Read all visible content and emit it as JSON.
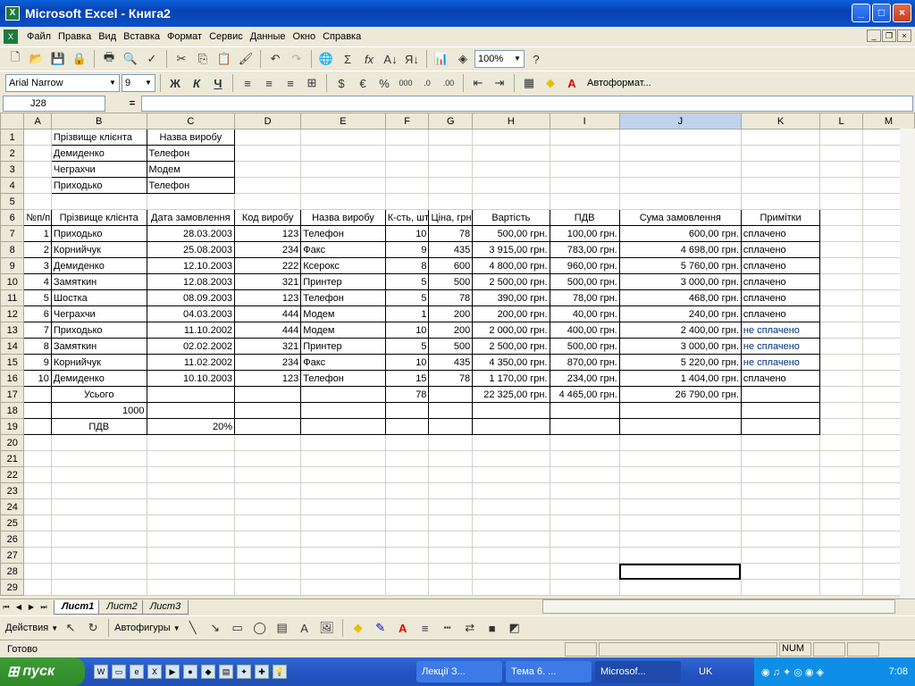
{
  "window": {
    "title": "Microsoft Excel - Книга2",
    "icon": "excel-icon"
  },
  "menu": [
    "Файл",
    "Правка",
    "Вид",
    "Вставка",
    "Формат",
    "Сервис",
    "Данные",
    "Окно",
    "Справка"
  ],
  "toolbar": {
    "zoom": "100%",
    "font": "Arial Narrow",
    "size": "9",
    "autoformat": "Автоформат..."
  },
  "formula_bar": {
    "cell": "J28",
    "fx": "="
  },
  "columns": [
    "A",
    "B",
    "C",
    "D",
    "E",
    "F",
    "G",
    "H",
    "I",
    "J",
    "K",
    "L",
    "M"
  ],
  "rows": [
    [
      "1",
      "",
      "Прізвище клієнта",
      "Назва виробу",
      "",
      "",
      "",
      "",
      "",
      "",
      "",
      "",
      "",
      ""
    ],
    [
      "2",
      "",
      "Демиденко",
      "Телефон",
      "",
      "",
      "",
      "",
      "",
      "",
      "",
      "",
      "",
      ""
    ],
    [
      "3",
      "",
      "Чеграхчи",
      "Модем",
      "",
      "",
      "",
      "",
      "",
      "",
      "",
      "",
      "",
      ""
    ],
    [
      "4",
      "",
      "Приходько",
      "Телефон",
      "",
      "",
      "",
      "",
      "",
      "",
      "",
      "",
      "",
      ""
    ],
    [
      "5",
      "",
      "",
      "",
      "",
      "",
      "",
      "",
      "",
      "",
      "",
      "",
      "",
      ""
    ],
    [
      "6",
      "№п/п",
      "Прізвище клієнта",
      "Дата замовлення",
      "Код виробу",
      "Назва виробу",
      "К-сть, шт",
      "Ціна, грн",
      "Вартість",
      "ПДВ",
      "Сума замовлення",
      "Примітки",
      "",
      ""
    ],
    [
      "7",
      "1",
      "Приходько",
      "28.03.2003",
      "123",
      "Телефон",
      "10",
      "78",
      "500,00 грн.",
      "100,00 грн.",
      "600,00 грн.",
      "сплачено",
      "",
      ""
    ],
    [
      "8",
      "2",
      "Корнийчук",
      "25.08.2003",
      "234",
      "Факс",
      "9",
      "435",
      "3 915,00 грн.",
      "783,00 грн.",
      "4 698,00 грн.",
      "сплачено",
      "",
      ""
    ],
    [
      "9",
      "3",
      "Демиденко",
      "12.10.2003",
      "222",
      "Ксерокс",
      "8",
      "600",
      "4 800,00 грн.",
      "960,00 грн.",
      "5 760,00 грн.",
      "сплачено",
      "",
      ""
    ],
    [
      "10",
      "4",
      "Замяткин",
      "12.08.2003",
      "321",
      "Принтер",
      "5",
      "500",
      "2 500,00 грн.",
      "500,00 грн.",
      "3 000,00 грн.",
      "сплачено",
      "",
      ""
    ],
    [
      "11",
      "5",
      "Шостка",
      "08.09.2003",
      "123",
      "Телефон",
      "5",
      "78",
      "390,00 грн.",
      "78,00 грн.",
      "468,00 грн.",
      "сплачено",
      "",
      ""
    ],
    [
      "12",
      "6",
      "Чеграхчи",
      "04.03.2003",
      "444",
      "Модем",
      "1",
      "200",
      "200,00 грн.",
      "40,00 грн.",
      "240,00 грн.",
      "сплачено",
      "",
      ""
    ],
    [
      "13",
      "7",
      "Приходько",
      "11.10.2002",
      "444",
      "Модем",
      "10",
      "200",
      "2 000,00 грн.",
      "400,00 грн.",
      "2 400,00 грн.",
      "не сплачено",
      "",
      ""
    ],
    [
      "14",
      "8",
      "Замяткин",
      "02.02.2002",
      "321",
      "Принтер",
      "5",
      "500",
      "2 500,00 грн.",
      "500,00 грн.",
      "3 000,00 грн.",
      "не сплачено",
      "",
      ""
    ],
    [
      "15",
      "9",
      "Корнийчук",
      "11.02.2002",
      "234",
      "Факс",
      "10",
      "435",
      "4 350,00 грн.",
      "870,00 грн.",
      "5 220,00 грн.",
      "не сплачено",
      "",
      ""
    ],
    [
      "16",
      "10",
      "Демиденко",
      "10.10.2003",
      "123",
      "Телефон",
      "15",
      "78",
      "1 170,00 грн.",
      "234,00 грн.",
      "1 404,00 грн.",
      "сплачено",
      "",
      ""
    ],
    [
      "17",
      "",
      "Усього",
      "",
      "",
      "",
      "78",
      "",
      "22 325,00 грн.",
      "4 465,00 грн.",
      "26 790,00 грн.",
      "",
      "",
      ""
    ],
    [
      "18",
      "",
      "1000",
      "",
      "",
      "",
      "",
      "",
      "",
      "",
      "",
      "",
      "",
      ""
    ],
    [
      "19",
      "",
      "ПДВ",
      "20%",
      "",
      "",
      "",
      "",
      "",
      "",
      "",
      "",
      "",
      ""
    ],
    [
      "20",
      "",
      "",
      "",
      "",
      "",
      "",
      "",
      "",
      "",
      "",
      "",
      "",
      ""
    ],
    [
      "21",
      "",
      "",
      "",
      "",
      "",
      "",
      "",
      "",
      "",
      "",
      "",
      "",
      ""
    ],
    [
      "22",
      "",
      "",
      "",
      "",
      "",
      "",
      "",
      "",
      "",
      "",
      "",
      "",
      ""
    ],
    [
      "23",
      "",
      "",
      "",
      "",
      "",
      "",
      "",
      "",
      "",
      "",
      "",
      "",
      ""
    ],
    [
      "24",
      "",
      "",
      "",
      "",
      "",
      "",
      "",
      "",
      "",
      "",
      "",
      "",
      ""
    ],
    [
      "25",
      "",
      "",
      "",
      "",
      "",
      "",
      "",
      "",
      "",
      "",
      "",
      "",
      ""
    ],
    [
      "26",
      "",
      "",
      "",
      "",
      "",
      "",
      "",
      "",
      "",
      "",
      "",
      "",
      ""
    ],
    [
      "27",
      "",
      "",
      "",
      "",
      "",
      "",
      "",
      "",
      "",
      "",
      "",
      "",
      ""
    ],
    [
      "28",
      "",
      "",
      "",
      "",
      "",
      "",
      "",
      "",
      "",
      "",
      "",
      "",
      ""
    ],
    [
      "29",
      "",
      "",
      "",
      "",
      "",
      "",
      "",
      "",
      "",
      "",
      "",
      "",
      ""
    ]
  ],
  "sheets": [
    "Лист1",
    "Лист2",
    "Лист3"
  ],
  "drawing": {
    "actions": "Действия",
    "autoshapes": "Автофигуры"
  },
  "status": {
    "text": "Готово",
    "num": "NUM"
  },
  "taskbar": {
    "start": "пуск",
    "tasks": [
      "Лекції З...",
      "Тема 6. ...",
      "Microsof..."
    ],
    "lang": "UK",
    "clock": "7:08"
  }
}
